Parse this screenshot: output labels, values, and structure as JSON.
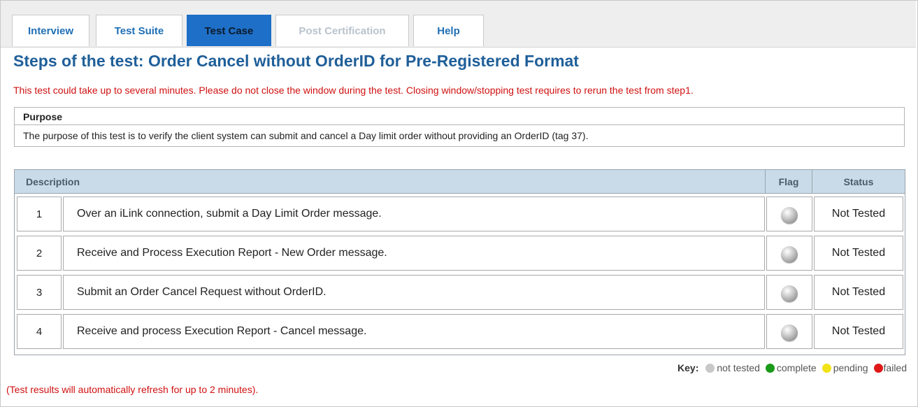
{
  "tabs": [
    {
      "label": "Interview",
      "state": "normal"
    },
    {
      "label": "Test Suite",
      "state": "normal"
    },
    {
      "label": "Test Case",
      "state": "active"
    },
    {
      "label": "Post Certification",
      "state": "disabled"
    },
    {
      "label": "Help",
      "state": "normal"
    }
  ],
  "page_title": "Steps of the test: Order Cancel without OrderID for Pre-Registered Format",
  "warning_text": "This test could take up to several minutes. Please do not close the window during the test. Closing window/stopping test requires to rerun the test from step1.",
  "purpose": {
    "heading": "Purpose",
    "text": "The purpose of this test is to verify the client system can submit and cancel a Day limit order without providing an OrderID (tag 37)."
  },
  "steps_table": {
    "headers": {
      "description": "Description",
      "flag": "Flag",
      "status": "Status"
    },
    "rows": [
      {
        "num": "1",
        "description": "Over an iLink connection, submit a Day Limit Order message.",
        "flag": "not tested",
        "status": "Not Tested"
      },
      {
        "num": "2",
        "description": "Receive and Process Execution Report - New Order message.",
        "flag": "not tested",
        "status": "Not Tested"
      },
      {
        "num": "3",
        "description": "Submit an Order Cancel Request without OrderID.",
        "flag": "not tested",
        "status": "Not Tested"
      },
      {
        "num": "4",
        "description": "Receive and process Execution Report - Cancel message.",
        "flag": "not tested",
        "status": "Not Tested"
      }
    ]
  },
  "key": {
    "label": "Key:",
    "items": [
      {
        "text": "not tested",
        "color": "#c8c8c8"
      },
      {
        "text": "complete",
        "color": "#1a9a1a"
      },
      {
        "text": "pending",
        "color": "#f2e218"
      },
      {
        "text": "failed",
        "color": "#e01818"
      }
    ]
  },
  "refresh_note": "(Test results will automatically refresh for up to 2 minutes).",
  "colors": {
    "tab_text": "#1f6fb5",
    "tab_active_bg": "#1e6fc7",
    "title": "#1f5f99",
    "warning": "#d01010",
    "table_header_bg": "#c9dbe9"
  }
}
